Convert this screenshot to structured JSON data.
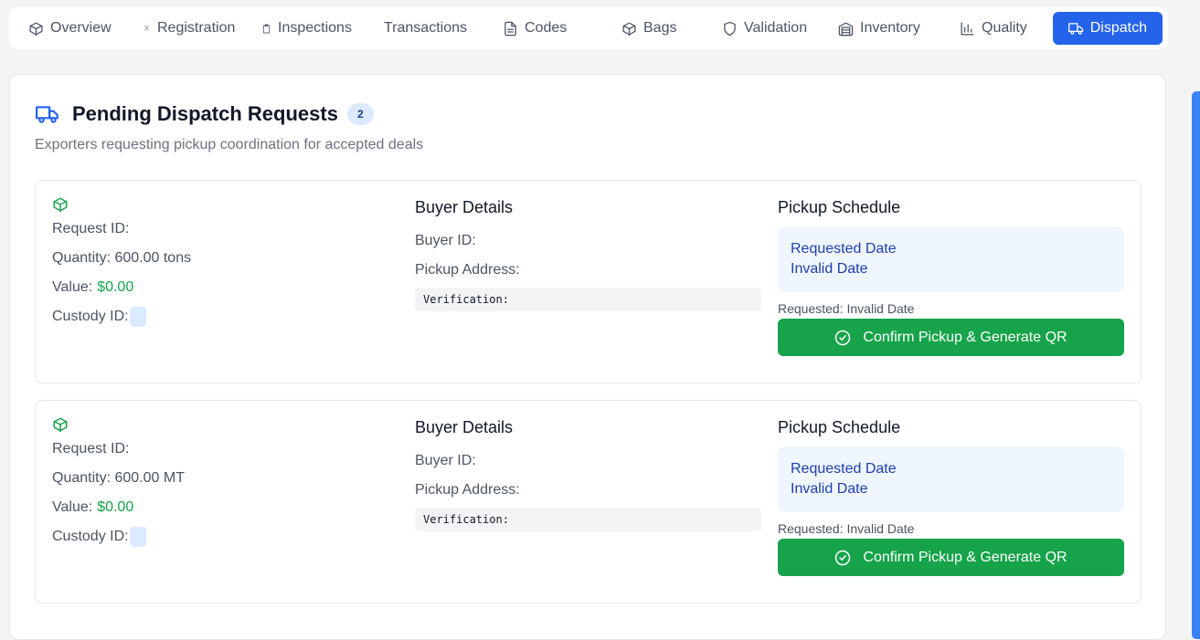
{
  "tabs": [
    {
      "label": "Overview",
      "icon": "box-icon"
    },
    {
      "label": "Registration",
      "icon": "small-dot-icon"
    },
    {
      "label": "Inspections",
      "icon": "clipboard-icon"
    },
    {
      "label": "Transactions",
      "icon": ""
    },
    {
      "label": "Codes",
      "icon": "document-icon"
    },
    {
      "label": "Bags",
      "icon": "box-icon"
    },
    {
      "label": "Validation",
      "icon": "shield-icon"
    },
    {
      "label": "Inventory",
      "icon": "warehouse-icon"
    },
    {
      "label": "Quality",
      "icon": "bar-chart-icon"
    },
    {
      "label": "Dispatch",
      "icon": "truck-icon",
      "active": true
    }
  ],
  "panel": {
    "title": "Pending Dispatch Requests",
    "count": "2",
    "subtitle": "Exporters requesting pickup coordination for accepted deals"
  },
  "requests": [
    {
      "request_id_label": "Request ID:",
      "quantity": "Quantity: 600.00 tons",
      "value_label": "Value:",
      "value": "$0.00",
      "custody_label": "Custody ID:",
      "buyer_title": "Buyer Details",
      "buyer_id_label": "Buyer ID:",
      "pickup_address_label": "Pickup Address:",
      "verification_label": "Verification:",
      "schedule_title": "Pickup Schedule",
      "requested_date_label": "Requested Date",
      "requested_date_value": "Invalid Date",
      "requested_note": "Requested: Invalid Date",
      "confirm_label": "Confirm Pickup & Generate QR"
    },
    {
      "request_id_label": "Request ID:",
      "quantity": "Quantity: 600.00 MT",
      "value_label": "Value:",
      "value": "$0.00",
      "custody_label": "Custody ID:",
      "buyer_title": "Buyer Details",
      "buyer_id_label": "Buyer ID:",
      "pickup_address_label": "Pickup Address:",
      "verification_label": "Verification:",
      "schedule_title": "Pickup Schedule",
      "requested_date_label": "Requested Date",
      "requested_date_value": "Invalid Date",
      "requested_note": "Requested: Invalid Date",
      "confirm_label": "Confirm Pickup & Generate QR"
    }
  ],
  "colors": {
    "accent": "#2563eb",
    "success": "#16a34a",
    "badge_bg": "#dbeafe"
  }
}
